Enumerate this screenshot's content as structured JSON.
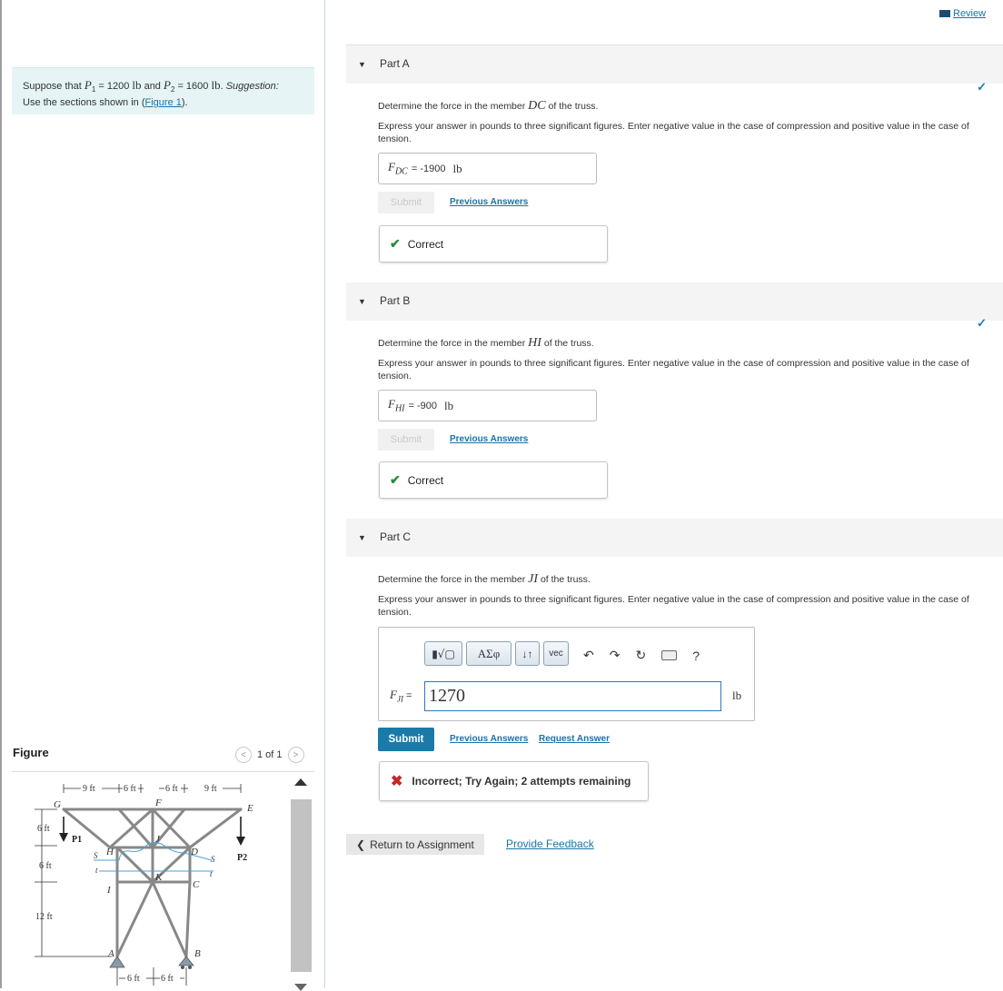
{
  "review": {
    "label": "Review"
  },
  "problem": {
    "text_suppose": "Suppose that",
    "p1_symbol": "P",
    "p1_sub": "1",
    "p1_value": " = 1200 ",
    "unit_lb": "lb",
    "and": " and ",
    "p2_symbol": "P",
    "p2_sub": "2",
    "p2_value": " = 1600 ",
    "suggestion": "Suggestion:",
    "use_sections": "Use the sections shown in (",
    "figure_link": "Figure 1",
    "close": ")."
  },
  "figure": {
    "label": "Figure",
    "pager": "1 of 1",
    "dims": {
      "top": [
        "9 ft",
        "6 ft",
        "6 ft",
        "9 ft"
      ],
      "left": [
        "6 ft",
        "6 ft",
        "12 ft"
      ],
      "bottom": [
        "6 ft",
        "6 ft"
      ]
    },
    "nodes": [
      "G",
      "F",
      "E",
      "H",
      "J",
      "D",
      "I",
      "K",
      "C",
      "A",
      "B"
    ],
    "loads": [
      "P1",
      "P2"
    ],
    "section_marks": [
      "S",
      "S",
      "t",
      "t"
    ]
  },
  "parts": [
    {
      "title": "Part A",
      "question_prefix": "Determine the force in the member ",
      "member": "DC",
      "question_suffix": " of the truss.",
      "instructions": "Express your answer in pounds to three significant figures. Enter negative value in the case of compression and positive value in the case of tension.",
      "answer_label": "F",
      "answer_sub": "DC",
      "answer_value": " = -1900",
      "answer_unit": "lb",
      "submit_label": "Submit",
      "prev_answers": "Previous Answers",
      "feedback": "Correct"
    },
    {
      "title": "Part B",
      "question_prefix": "Determine the force in the member ",
      "member": "HI",
      "question_suffix": " of the truss.",
      "instructions": "Express your answer in pounds to three significant figures. Enter negative value in the case of compression and positive value in the case of tension.",
      "answer_label": "F",
      "answer_sub": "HI",
      "answer_value": " = -900",
      "answer_unit": "lb",
      "submit_label": "Submit",
      "prev_answers": "Previous Answers",
      "feedback": "Correct"
    },
    {
      "title": "Part C",
      "question_prefix": "Determine the force in the member ",
      "member": "JI",
      "question_suffix": " of the truss.",
      "instructions": "Express your answer in pounds to three significant figures. Enter negative value in the case of compression and positive value in the case of tension.",
      "answer_label": "F",
      "answer_sub": "JI",
      "answer_eq": " =",
      "answer_value": "1270",
      "answer_unit": "lb",
      "toolbar": {
        "greek": "ΑΣφ",
        "arrows": "↓↑",
        "vec": "vec",
        "help": "?"
      },
      "submit_label": "Submit",
      "prev_answers": "Previous Answers",
      "request_answer": "Request Answer",
      "feedback": "Incorrect; Try Again; 2 attempts remaining"
    }
  ],
  "footer": {
    "return": "Return to Assignment",
    "provide_feedback": "Provide Feedback"
  }
}
